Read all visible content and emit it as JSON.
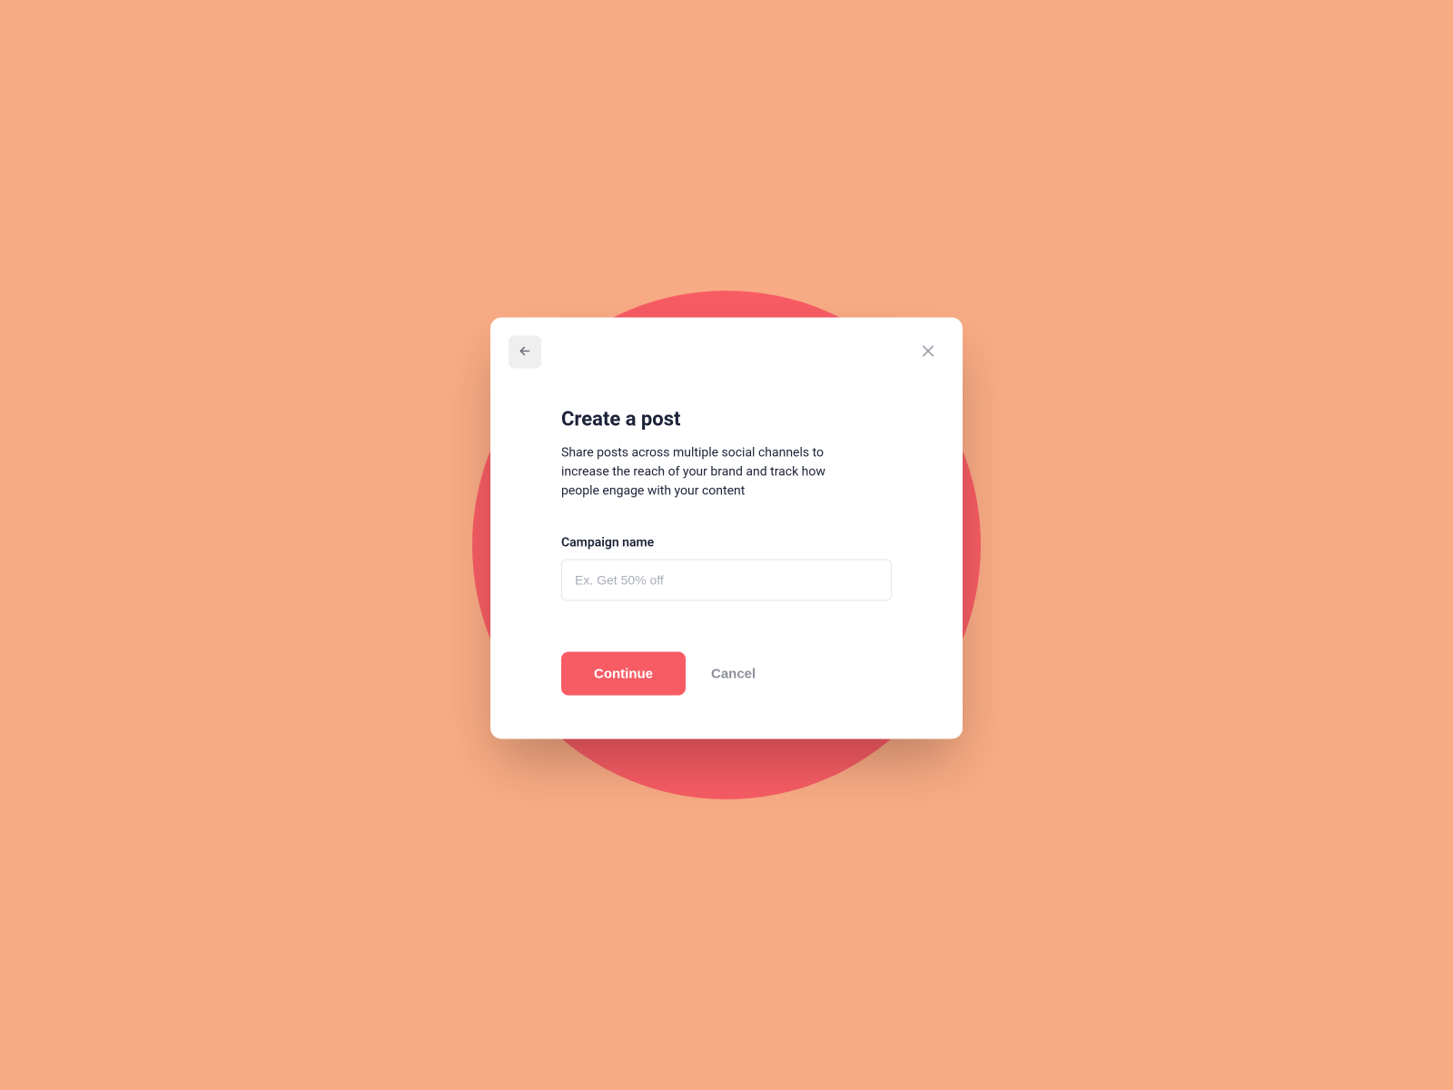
{
  "modal": {
    "title": "Create a post",
    "description": "Share posts across multiple social channels to increase the reach of your brand and track how people engage with your content",
    "field": {
      "label": "Campaign name",
      "placeholder": "Ex. Get 50% off",
      "value": ""
    },
    "actions": {
      "primary": "Continue",
      "secondary": "Cancel"
    }
  },
  "colors": {
    "page_bg": "#F8AB84",
    "circle_bg": "#F75C64",
    "accent": "#F75C64",
    "text_primary": "#1C2238",
    "text_muted": "#8D8F9C"
  }
}
